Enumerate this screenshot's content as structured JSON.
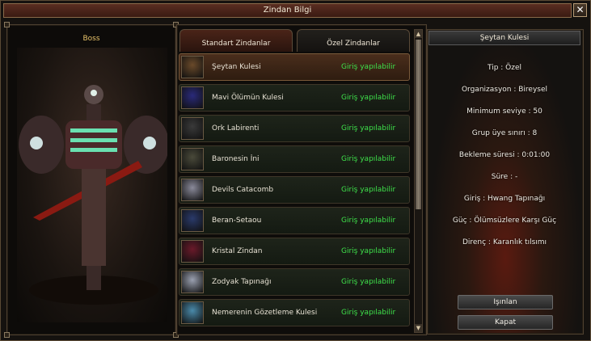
{
  "window": {
    "title": "Zindan Bilgi",
    "close_label": "✕"
  },
  "boss": {
    "label": "Boss"
  },
  "tabs": [
    {
      "label": "Standart Zindanlar",
      "active": true
    },
    {
      "label": "Özel Zindanlar",
      "active": false
    }
  ],
  "dungeons": [
    {
      "name": "Şeytan Kulesi",
      "status": "Giriş yapılabilir",
      "selected": true,
      "thumb_color": "#6a4a2a"
    },
    {
      "name": "Mavi Ölümün Kulesi",
      "status": "Giriş yapılabilir",
      "selected": false,
      "thumb_color": "#2a2a7a"
    },
    {
      "name": "Ork Labirenti",
      "status": "Giriş yapılabilir",
      "selected": false,
      "thumb_color": "#3a3a3a"
    },
    {
      "name": "Baronesin İni",
      "status": "Giriş yapılabilir",
      "selected": false,
      "thumb_color": "#4a4a3a"
    },
    {
      "name": "Devils Catacomb",
      "status": "Giriş yapılabilir",
      "selected": false,
      "thumb_color": "#8a8a9a"
    },
    {
      "name": "Beran-Setaou",
      "status": "Giriş yapılabilir",
      "selected": false,
      "thumb_color": "#2a3a6a"
    },
    {
      "name": "Kristal Zindan",
      "status": "Giriş yapılabilir",
      "selected": false,
      "thumb_color": "#6a1a2a"
    },
    {
      "name": "Zodyak Tapınağı",
      "status": "Giriş yapılabilir",
      "selected": false,
      "thumb_color": "#9aa0b0"
    },
    {
      "name": "Nemerenin Gözetleme Kulesi",
      "status": "Giriş yapılabilir",
      "selected": false,
      "thumb_color": "#4a8aaa"
    }
  ],
  "info": {
    "title": "Şeytan Kulesi",
    "lines": [
      "Tip : Özel",
      "Organizasyon : Bireysel",
      "Minimum seviye : 50",
      "Grup üye sınırı : 8",
      "Bekleme süresi : 0:01:00",
      "Süre :  -",
      "Giriş : Hwang Tapınağı",
      "Güç : Ölümsüzlere Karşı Güç",
      "Direnç : Karanlık tılsımı"
    ]
  },
  "buttons": {
    "teleport": "Işınlan",
    "close": "Kapat"
  },
  "colors": {
    "status_green": "#3ee04a",
    "boss_label": "#e8c36a"
  }
}
